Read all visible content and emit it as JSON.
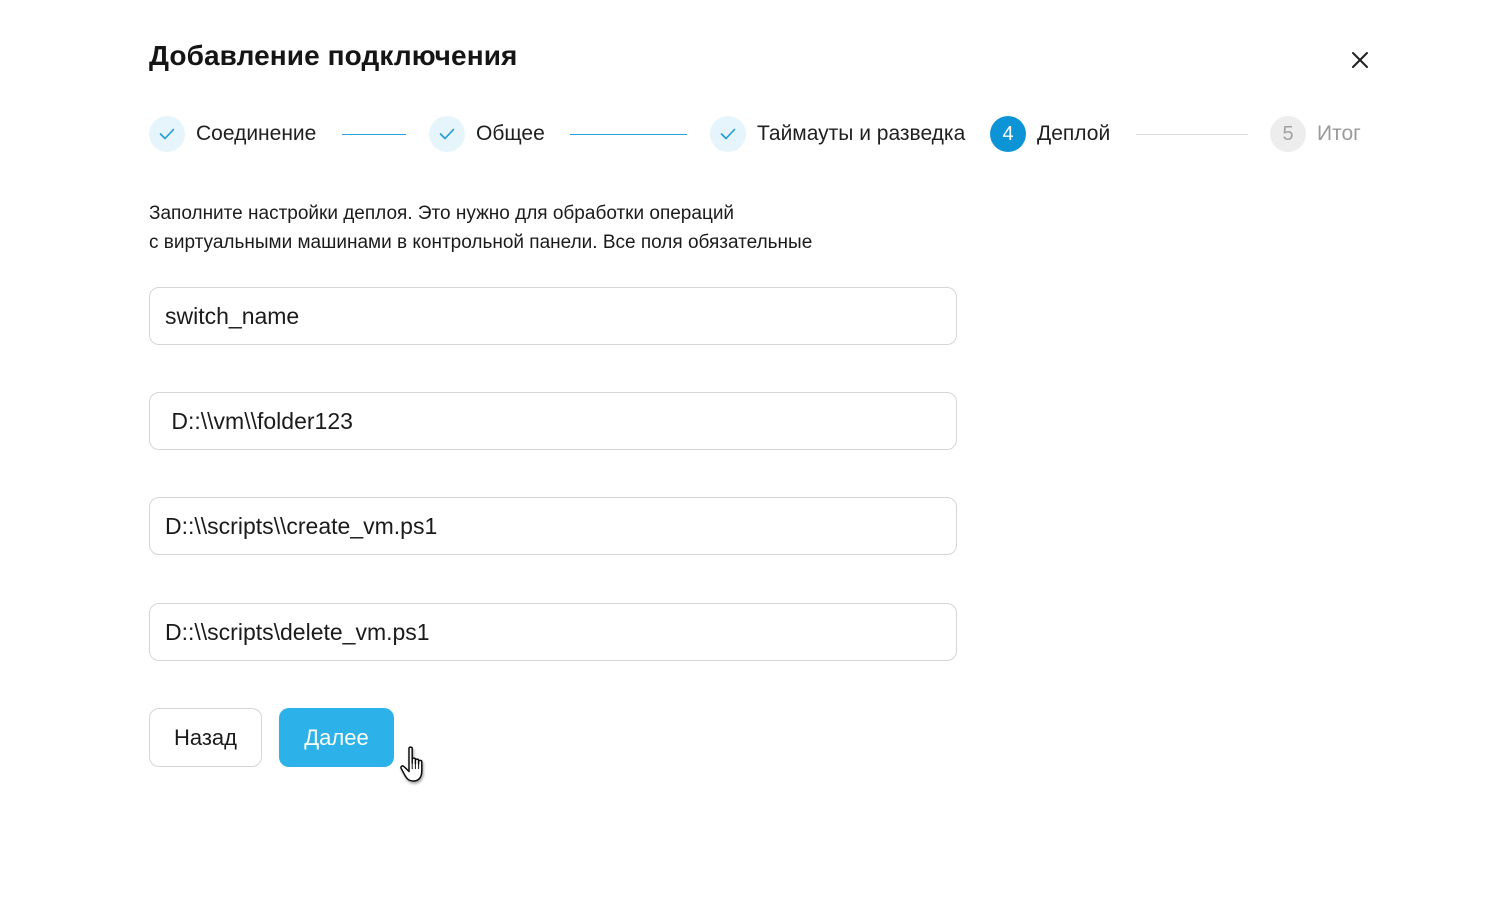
{
  "dialog": {
    "title": "Добавление подключения",
    "close_icon": "close-icon"
  },
  "stepper": {
    "accent_color": "#0d94d6",
    "steps": [
      {
        "marker": "✓",
        "label": "Соединение",
        "state": "done"
      },
      {
        "marker": "✓",
        "label": "Общее",
        "state": "done"
      },
      {
        "marker": "✓",
        "label": "Таймауты и разведка",
        "state": "done"
      },
      {
        "marker": "4",
        "label": "Деплой",
        "state": "active"
      },
      {
        "marker": "5",
        "label": "Итог",
        "state": "pending"
      }
    ]
  },
  "description": {
    "line1": "Заполните настройки деплоя. Это нужно для обработки операций",
    "line2": "с виртуальными машинами в контрольной панели. Все поля обязательные"
  },
  "fields": [
    {
      "value": "switch_name"
    },
    {
      "value": " D::\\\\vm\\\\folder123"
    },
    {
      "value": "D::\\\\scripts\\\\create_vm.ps1"
    },
    {
      "value": "D::\\\\scripts\\delete_vm.ps1"
    }
  ],
  "buttons": {
    "back_label": "Назад",
    "next_label": "Далее",
    "next_color": "#2cb2e8"
  },
  "cursor": {
    "icon": "hand-pointer-icon"
  }
}
